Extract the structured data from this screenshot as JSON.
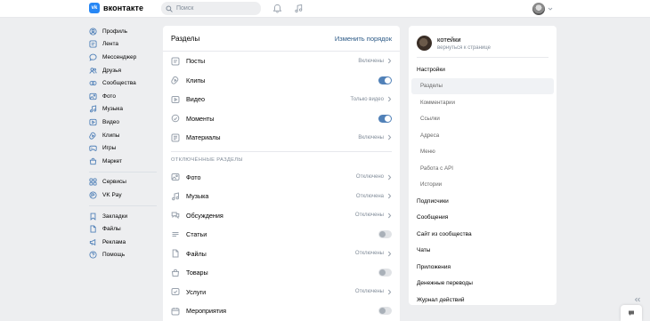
{
  "header": {
    "logo_letter": "vk",
    "logo_text": "вконтакте",
    "search_placeholder": "Поиск",
    "icons": [
      "bell-icon",
      "music-note-icon"
    ]
  },
  "leftnav": {
    "groups": [
      [
        {
          "label": "Профиль",
          "icon": "user-circle-icon"
        },
        {
          "label": "Лента",
          "icon": "newsfeed-icon"
        },
        {
          "label": "Мессенджер",
          "icon": "message-bubble-icon"
        },
        {
          "label": "Друзья",
          "icon": "friends-icon"
        },
        {
          "label": "Сообщества",
          "icon": "communities-icon"
        },
        {
          "label": "Фото",
          "icon": "photo-icon"
        },
        {
          "label": "Музыка",
          "icon": "music-icon"
        },
        {
          "label": "Видео",
          "icon": "video-icon"
        },
        {
          "label": "Клипы",
          "icon": "clips-icon"
        },
        {
          "label": "Игры",
          "icon": "gamepad-icon"
        },
        {
          "label": "Маркет",
          "icon": "market-bag-icon"
        }
      ],
      [
        {
          "label": "Сервисы",
          "icon": "services-icon"
        },
        {
          "label": "VK Pay",
          "icon": "vkpay-icon"
        }
      ],
      [
        {
          "label": "Закладки",
          "icon": "bookmark-icon"
        },
        {
          "label": "Файлы",
          "icon": "file-icon"
        },
        {
          "label": "Реклама",
          "icon": "megaphone-icon"
        },
        {
          "label": "Помощь",
          "icon": "help-icon"
        }
      ]
    ]
  },
  "main": {
    "title": "Разделы",
    "action": "Изменить порядок",
    "enabled_rows": [
      {
        "label": "Посты",
        "icon": "posts-icon",
        "type": "value",
        "value": "Включены"
      },
      {
        "label": "Клипы",
        "icon": "clips-icon",
        "type": "toggle",
        "on": true
      },
      {
        "label": "Видео",
        "icon": "video-icon",
        "type": "value",
        "value": "Только видео"
      },
      {
        "label": "Моменты",
        "icon": "moments-icon",
        "type": "toggle",
        "on": true
      },
      {
        "label": "Материалы",
        "icon": "materials-icon",
        "type": "value",
        "value": "Включены"
      }
    ],
    "disabled_title": "ОТКЛЮЧЁННЫЕ РАЗДЕЛЫ",
    "disabled_rows": [
      {
        "label": "Фото",
        "icon": "photo-icon",
        "type": "value",
        "value": "Отключено"
      },
      {
        "label": "Музыка",
        "icon": "music-icon",
        "type": "value",
        "value": "Отключена"
      },
      {
        "label": "Обсуждения",
        "icon": "discussion-icon",
        "type": "value",
        "value": "Отключены"
      },
      {
        "label": "Статьи",
        "icon": "articles-icon",
        "type": "toggle",
        "on": false
      },
      {
        "label": "Файлы",
        "icon": "file-icon",
        "type": "value",
        "value": "Отключены"
      },
      {
        "label": "Товары",
        "icon": "goods-bag-icon",
        "type": "toggle",
        "on": false
      },
      {
        "label": "Услуги",
        "icon": "services-check-icon",
        "type": "value",
        "value": "Отключены"
      },
      {
        "label": "Мероприятия",
        "icon": "calendar-icon",
        "type": "toggle",
        "on": false
      }
    ]
  },
  "right": {
    "group_name": "котейки",
    "back_link": "вернуться к странице",
    "items": [
      {
        "label": "Настройки",
        "level": "top",
        "active": false
      },
      {
        "label": "Разделы",
        "level": "sub",
        "active": true
      },
      {
        "label": "Комментарии",
        "level": "sub",
        "active": false
      },
      {
        "label": "Ссылки",
        "level": "sub",
        "active": false
      },
      {
        "label": "Адреса",
        "level": "sub",
        "active": false
      },
      {
        "label": "Меню",
        "level": "sub",
        "active": false
      },
      {
        "label": "Работа с API",
        "level": "sub",
        "active": false
      },
      {
        "label": "Истории",
        "level": "sub",
        "active": false
      },
      {
        "label": "Подписчики",
        "level": "top",
        "active": false
      },
      {
        "label": "Сообщения",
        "level": "top",
        "active": false
      },
      {
        "label": "Сайт из сообщества",
        "level": "top",
        "active": false
      },
      {
        "label": "Чаты",
        "level": "top",
        "active": false
      },
      {
        "label": "Приложения",
        "level": "top",
        "active": false
      },
      {
        "label": "Денежные переводы",
        "level": "top",
        "active": false
      },
      {
        "label": "Журнал действий",
        "level": "top",
        "active": false
      }
    ]
  },
  "colors": {
    "accent": "#5181b8",
    "link": "#2a5885",
    "background": "#edeef0",
    "muted": "#818c99"
  }
}
